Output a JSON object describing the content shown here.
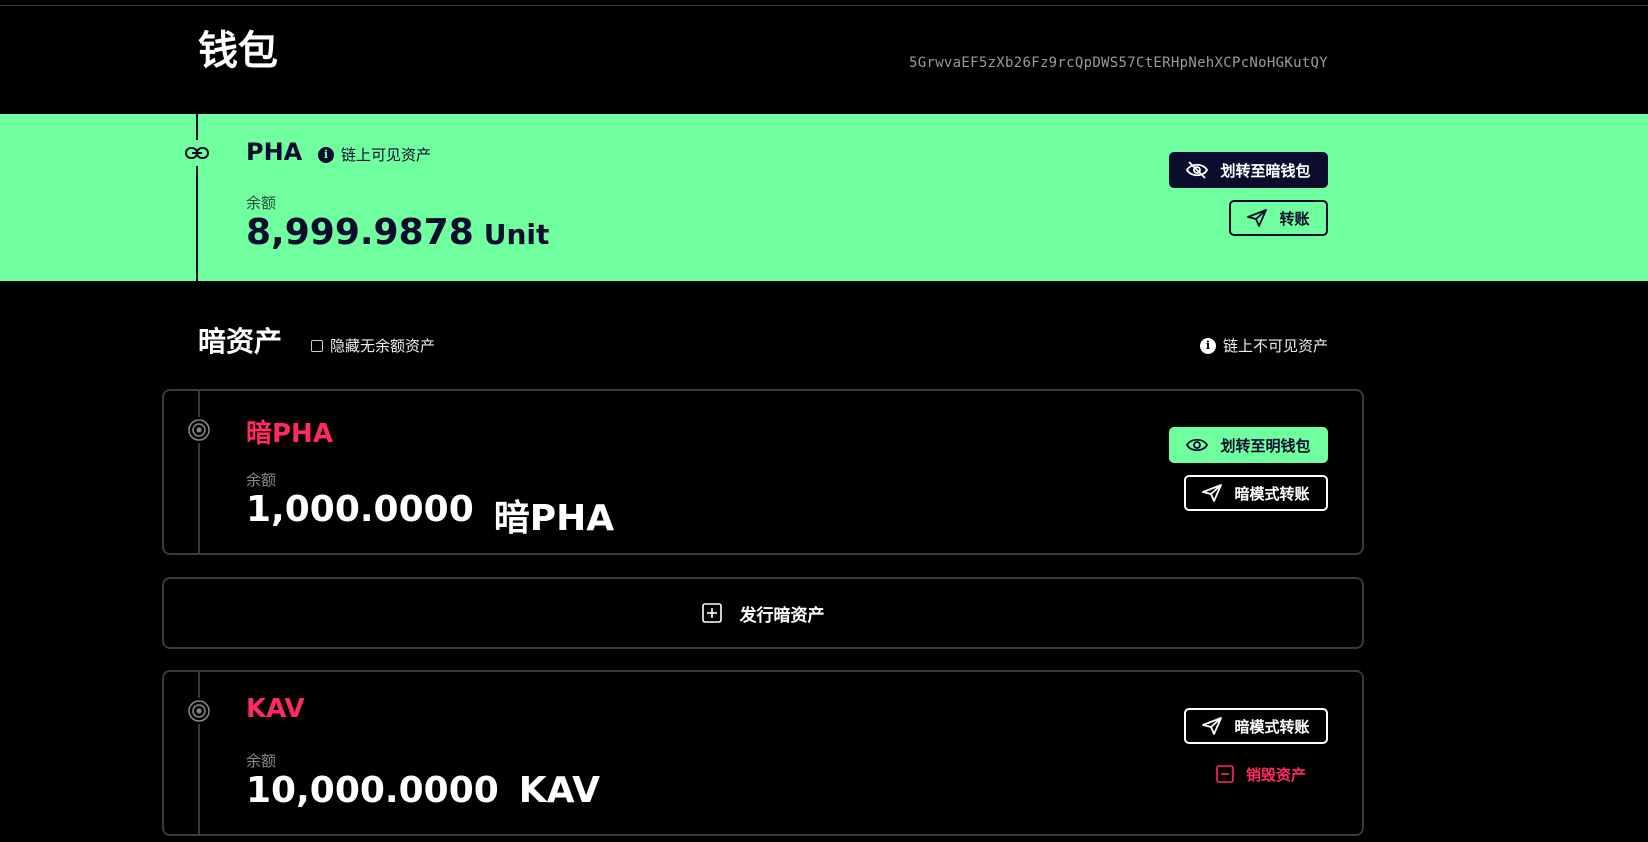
{
  "header": {
    "title": "钱包",
    "address": "5GrwvaEF5zXb26Fz9rcQpDWS57CtERHpNehXCPcNoHGKutQY"
  },
  "public_asset": {
    "name": "PHA",
    "visibility_label": "链上可见资产",
    "balance_label": "余额",
    "balance_value": "8,999.9878",
    "balance_unit": "Unit",
    "to_dark_wallet_label": "划转至暗钱包",
    "transfer_label": "转账",
    "colors": {
      "band": "#70ff9f",
      "ink": "#0c0c2e"
    }
  },
  "dark_assets": {
    "title": "暗资产",
    "hide_zero_label": "隐藏无余额资产",
    "hide_zero_checked": false,
    "visibility_label": "链上不可见资产",
    "issue_label": "发行暗资产",
    "assets": [
      {
        "name": "暗PHA",
        "balance_label": "余额",
        "balance_value": "1,000.0000",
        "balance_unit": "暗PHA",
        "to_public_wallet_label": "划转至明钱包",
        "dark_transfer_label": "暗模式转账"
      },
      {
        "name": "KAV",
        "balance_label": "余额",
        "balance_value": "10,000.0000",
        "balance_unit": "KAV",
        "dark_transfer_label": "暗模式转账",
        "destroy_label": "销毁资产"
      }
    ],
    "colors": {
      "accent": "#ff2a5f",
      "border": "#3a3a3a"
    }
  }
}
